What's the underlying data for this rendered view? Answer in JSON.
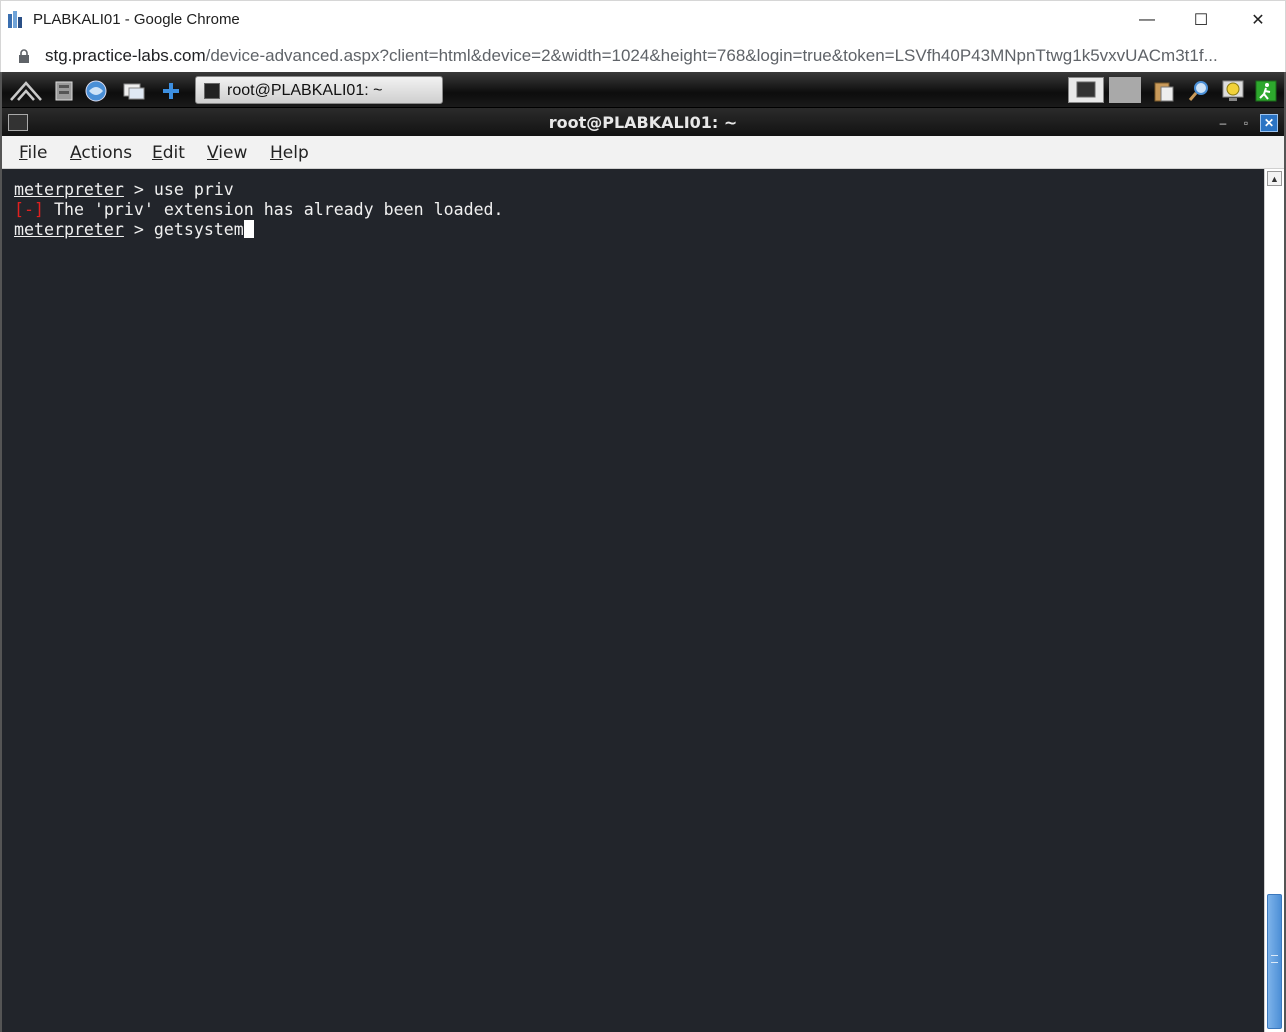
{
  "window": {
    "title": "PLABKALI01 - Google Chrome",
    "minimize_glyph": "—",
    "maximize_glyph": "☐",
    "close_glyph": "✕"
  },
  "address_bar": {
    "host": "stg.practice-labs.com",
    "path": "/device-advanced.aspx?client=html&device=2&width=1024&height=768&login=true&token=LSVfh40P43MNpnTtwg1k5vxvUACm3t1f..."
  },
  "panel": {
    "task_label": "root@PLABKALI01: ~"
  },
  "terminal_window": {
    "title": "root@PLABKALI01: ~",
    "min_glyph": "–",
    "max_glyph": "▫",
    "close_glyph": "✕"
  },
  "menu": {
    "file": {
      "u": "F",
      "rest": "ile"
    },
    "actions": {
      "u": "A",
      "rest": "ctions"
    },
    "edit": {
      "u": "E",
      "rest": "dit"
    },
    "view": {
      "u": "V",
      "rest": "iew"
    },
    "help": {
      "u": "H",
      "rest": "elp"
    }
  },
  "terminal": {
    "line1": {
      "prompt": "meterpreter",
      "text": " > use priv"
    },
    "line2": {
      "marker": "[-]",
      "text": " The 'priv' extension has already been loaded."
    },
    "line3": {
      "prompt": "meterpreter",
      "text": " > getsystem"
    }
  },
  "colors": {
    "terminal_bg": "#22252b",
    "error_red": "#e02020",
    "scroll_thumb": "#4d8fd6"
  }
}
